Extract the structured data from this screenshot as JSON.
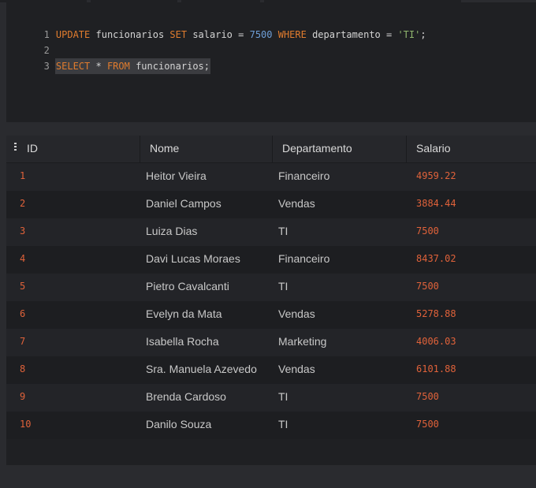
{
  "editor": {
    "lines": [
      {
        "num": "1",
        "tokens": [
          {
            "t": "UPDATE",
            "c": "kw"
          },
          {
            "t": " funcionarios ",
            "c": "plain"
          },
          {
            "t": "SET",
            "c": "kw"
          },
          {
            "t": " salario = ",
            "c": "plain"
          },
          {
            "t": "7500",
            "c": "num"
          },
          {
            "t": " ",
            "c": "plain"
          },
          {
            "t": "WHERE",
            "c": "kw"
          },
          {
            "t": " departamento = ",
            "c": "plain"
          },
          {
            "t": "'TI'",
            "c": "str"
          },
          {
            "t": ";",
            "c": "plain"
          }
        ]
      },
      {
        "num": "2",
        "tokens": []
      },
      {
        "num": "3",
        "tokens": [
          {
            "t": "SELECT",
            "c": "kw"
          },
          {
            "t": " * ",
            "c": "plain"
          },
          {
            "t": "FROM",
            "c": "kw"
          },
          {
            "t": " funcionarios;",
            "c": "plain"
          }
        ]
      }
    ]
  },
  "results": {
    "columns": [
      "ID",
      "Nome",
      "Departamento",
      "Salario"
    ],
    "rows": [
      {
        "id": "1",
        "nome": "Heitor Vieira",
        "departamento": "Financeiro",
        "salario": "4959.22"
      },
      {
        "id": "2",
        "nome": "Daniel Campos",
        "departamento": "Vendas",
        "salario": "3884.44"
      },
      {
        "id": "3",
        "nome": "Luiza Dias",
        "departamento": "TI",
        "salario": "7500"
      },
      {
        "id": "4",
        "nome": "Davi Lucas Moraes",
        "departamento": "Financeiro",
        "salario": "8437.02"
      },
      {
        "id": "5",
        "nome": "Pietro Cavalcanti",
        "departamento": "TI",
        "salario": "7500"
      },
      {
        "id": "6",
        "nome": "Evelyn da Mata",
        "departamento": "Vendas",
        "salario": "5278.88"
      },
      {
        "id": "7",
        "nome": "Isabella Rocha",
        "departamento": "Marketing",
        "salario": "4006.03"
      },
      {
        "id": "8",
        "nome": "Sra. Manuela Azevedo",
        "departamento": "Vendas",
        "salario": "6101.88"
      },
      {
        "id": "9",
        "nome": "Brenda Cardoso",
        "departamento": "TI",
        "salario": "7500"
      },
      {
        "id": "10",
        "nome": "Danilo Souza",
        "departamento": "TI",
        "salario": "7500"
      }
    ]
  },
  "colors": {
    "keyword": "#e07c2e",
    "number": "#6e9fd8",
    "string": "#8fb46d",
    "id_value": "#e0623a"
  },
  "icons": {
    "column_menu": "grip-icon"
  }
}
